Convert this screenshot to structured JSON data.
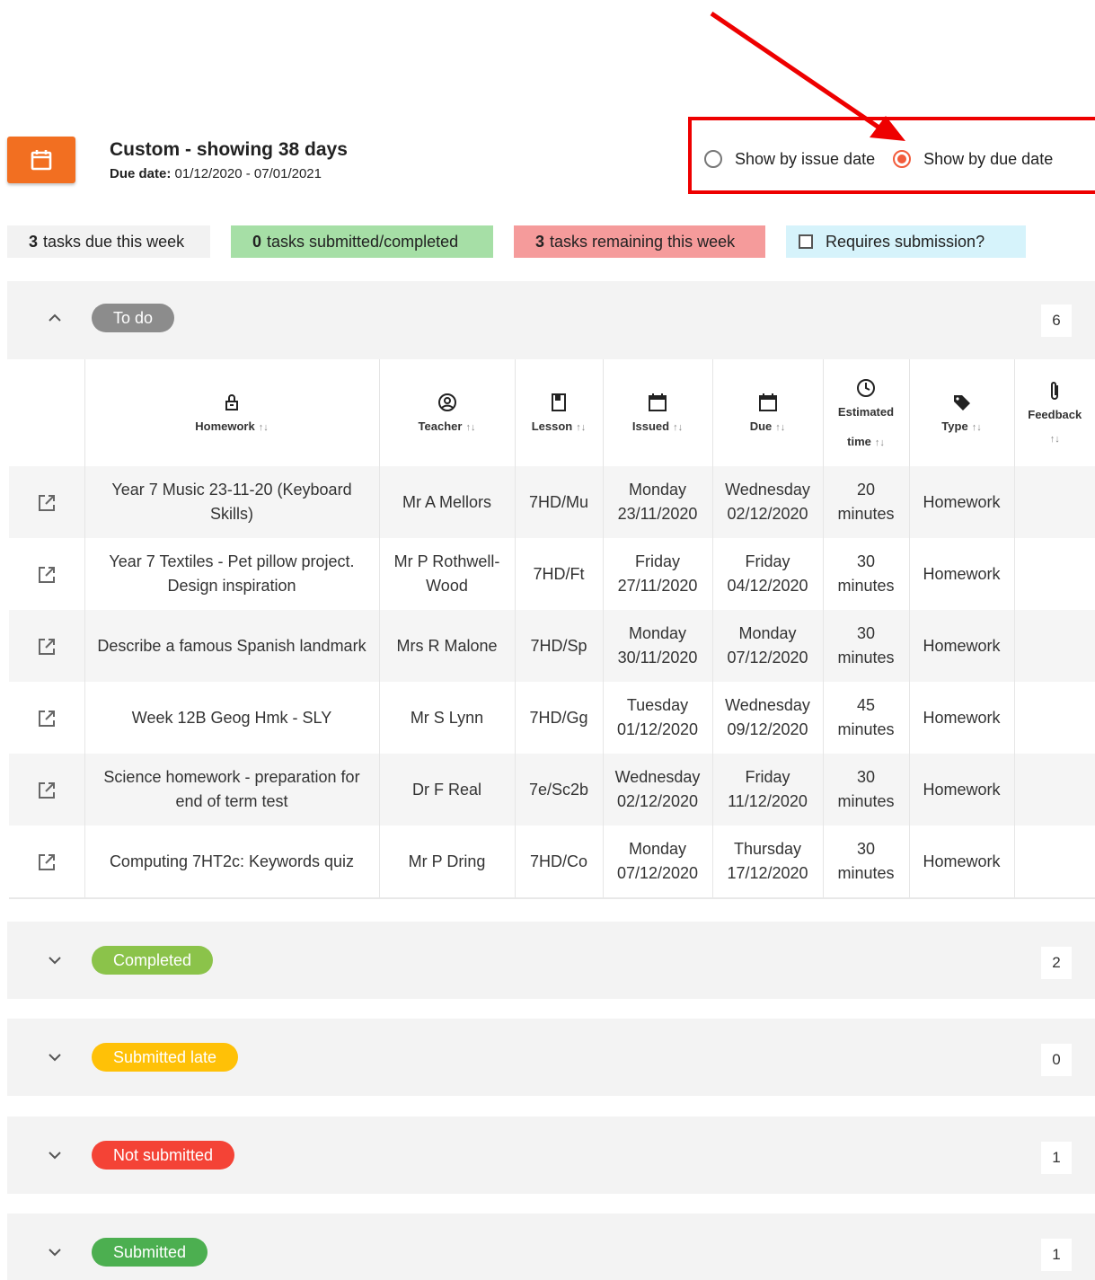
{
  "header": {
    "calendar_button_icon": "calendar-icon",
    "title": "Custom - showing 38 days",
    "due_label": "Due date:",
    "due_range": "01/12/2020 - 07/01/2021",
    "radio_issue_label": "Show by issue date",
    "radio_due_label": "Show by due date",
    "selected_radio": "due",
    "accent": "#f26f21",
    "annotation_color": "#ee0000"
  },
  "summary": {
    "due_week_count": "3",
    "due_week_text": "tasks due this week",
    "submitted_count": "0",
    "submitted_text": "tasks submitted/completed",
    "remaining_count": "3",
    "remaining_text": "tasks remaining this week",
    "requires_submission_label": "Requires submission?"
  },
  "todo": {
    "label": "To do",
    "count": "6",
    "color": "#8c8c8c"
  },
  "table": {
    "columns": {
      "homework": "Homework",
      "teacher": "Teacher",
      "lesson": "Lesson",
      "issued": "Issued",
      "due": "Due",
      "estimated_1": "Estimated",
      "estimated_2": "time",
      "type": "Type",
      "feedback": "Feedback"
    },
    "sort_glyph": "↑↓",
    "rows": [
      {
        "homework": "Year 7 Music 23-11-20 (Keyboard Skills)",
        "teacher": "Mr A Mellors",
        "lesson": "7HD/Mu",
        "issued_day": "Monday",
        "issued_date": "23/11/2020",
        "due_day": "Wednesday",
        "due_date": "02/12/2020",
        "time_num": "20",
        "time_unit": "minutes",
        "type": "Homework",
        "feedback": ""
      },
      {
        "homework": "Year 7 Textiles - Pet pillow project. Design inspiration",
        "teacher": "Mr P Rothwell-Wood",
        "lesson": "7HD/Ft",
        "issued_day": "Friday",
        "issued_date": "27/11/2020",
        "due_day": "Friday",
        "due_date": "04/12/2020",
        "time_num": "30",
        "time_unit": "minutes",
        "type": "Homework",
        "feedback": ""
      },
      {
        "homework": "Describe a famous Spanish landmark",
        "teacher": "Mrs R Malone",
        "lesson": "7HD/Sp",
        "issued_day": "Monday",
        "issued_date": "30/11/2020",
        "due_day": "Monday",
        "due_date": "07/12/2020",
        "time_num": "30",
        "time_unit": "minutes",
        "type": "Homework",
        "feedback": ""
      },
      {
        "homework": "Week 12B Geog Hmk - SLY",
        "teacher": "Mr S Lynn",
        "lesson": "7HD/Gg",
        "issued_day": "Tuesday",
        "issued_date": "01/12/2020",
        "due_day": "Wednesday",
        "due_date": "09/12/2020",
        "time_num": "45",
        "time_unit": "minutes",
        "type": "Homework",
        "feedback": ""
      },
      {
        "homework": "Science homework - preparation for end of term test",
        "teacher": "Dr F Real",
        "lesson": "7e/Sc2b",
        "issued_day": "Wednesday",
        "issued_date": "02/12/2020",
        "due_day": "Friday",
        "due_date": "11/12/2020",
        "time_num": "30",
        "time_unit": "minutes",
        "type": "Homework",
        "feedback": ""
      },
      {
        "homework": "Computing 7HT2c: Keywords quiz",
        "teacher": "Mr P Dring",
        "lesson": "7HD/Co",
        "issued_day": "Monday",
        "issued_date": "07/12/2020",
        "due_day": "Thursday",
        "due_date": "17/12/2020",
        "time_num": "30",
        "time_unit": "minutes",
        "type": "Homework",
        "feedback": ""
      }
    ]
  },
  "sections": [
    {
      "label": "Completed",
      "count": "2",
      "color": "#8bc34a"
    },
    {
      "label": "Submitted late",
      "count": "0",
      "color": "#ffc107"
    },
    {
      "label": "Not submitted",
      "count": "1",
      "color": "#f44336"
    },
    {
      "label": "Submitted",
      "count": "1",
      "color": "#4caf50"
    }
  ]
}
